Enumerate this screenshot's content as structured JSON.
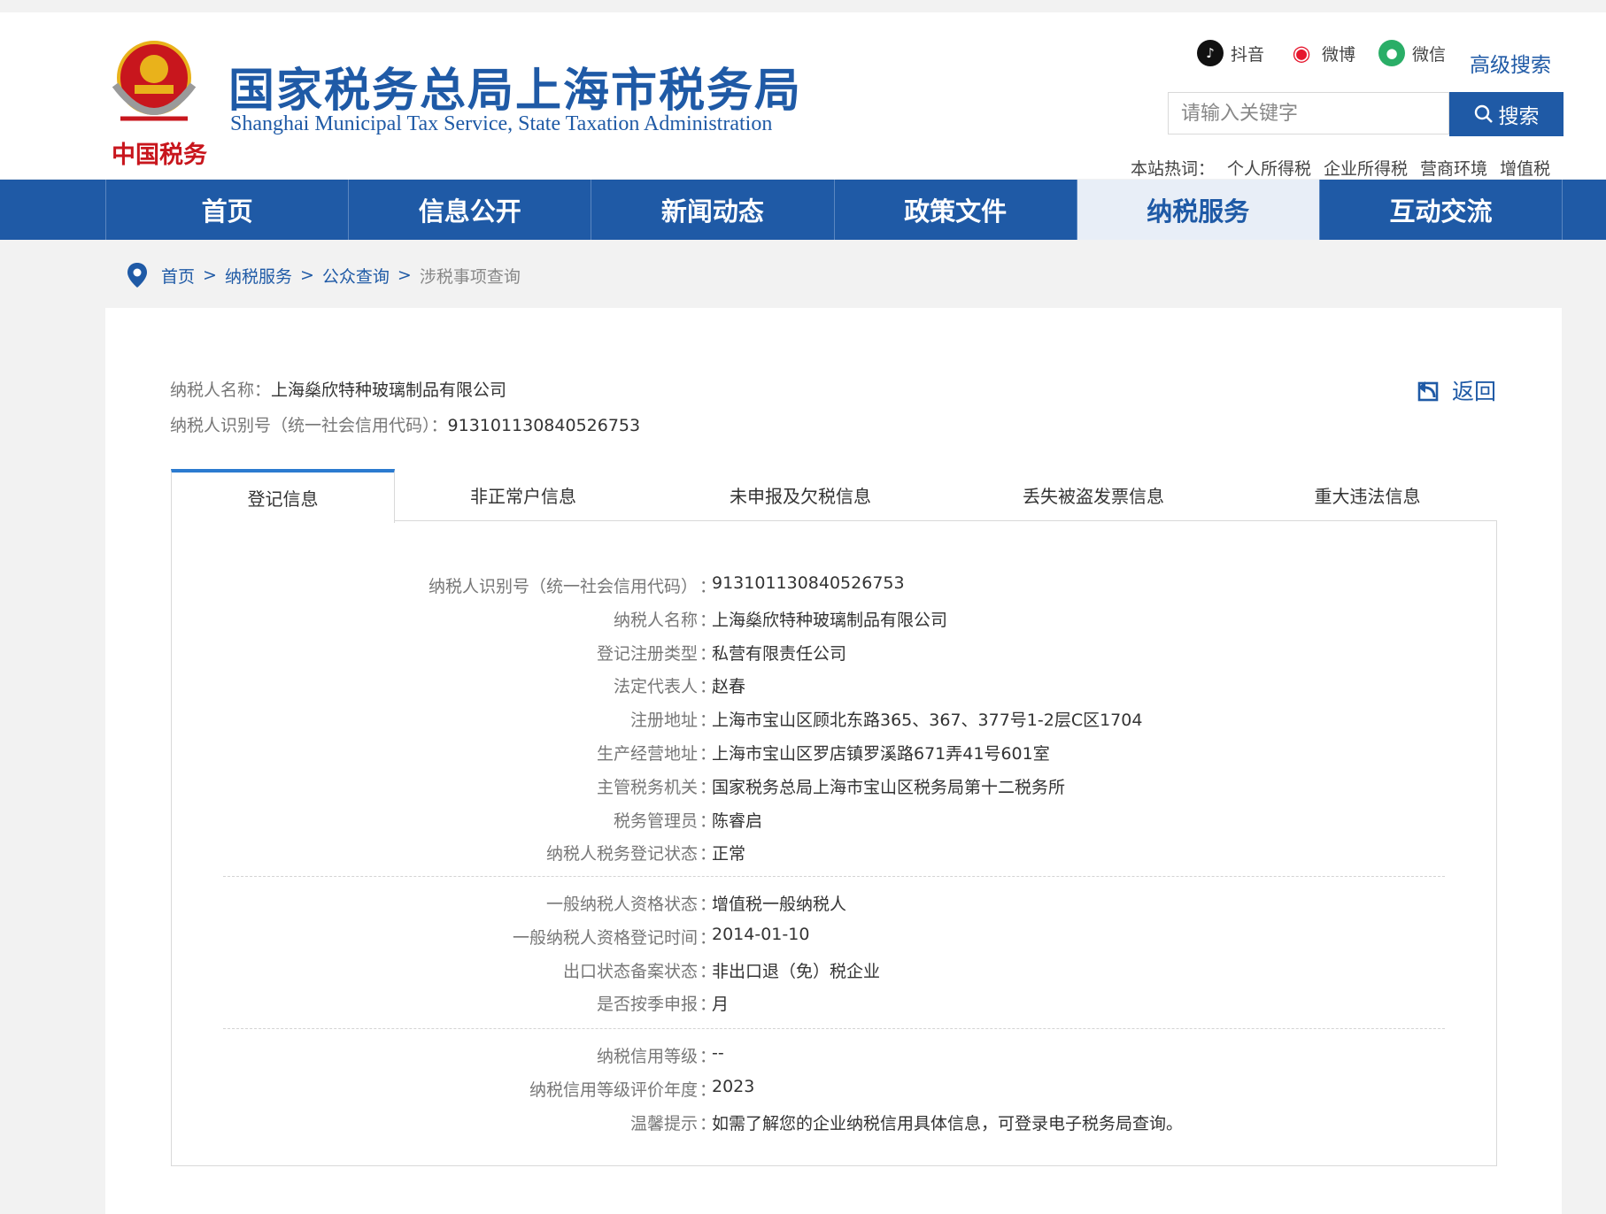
{
  "site": {
    "title": "国家税务总局上海市税务局",
    "subtitle": "Shanghai Municipal Tax Service, State Taxation Administration",
    "logo_text": "中国税务"
  },
  "social": [
    {
      "label": "抖音",
      "icon": "tiktok-icon",
      "color": "#111111"
    },
    {
      "label": "微博",
      "icon": "weibo-icon",
      "color": "#e6162d"
    },
    {
      "label": "微信",
      "icon": "wechat-icon",
      "color": "#2aae67"
    }
  ],
  "search": {
    "advanced_label": "高级搜索",
    "placeholder": "请输入关键字",
    "button_label": "搜索"
  },
  "hot": {
    "label": "本站热词：",
    "items": [
      "个人所得税",
      "企业所得税",
      "营商环境",
      "增值税"
    ]
  },
  "nav": {
    "items": [
      "首页",
      "信息公开",
      "新闻动态",
      "政策文件",
      "纳税服务",
      "互动交流"
    ],
    "active": "纳税服务"
  },
  "breadcrumb": {
    "items": [
      "首页",
      "纳税服务",
      "公众查询"
    ],
    "separator": ">",
    "current": "涉税事项查询"
  },
  "taxpayer": {
    "name_label": "纳税人名称：",
    "name": "上海燊欣特种玻璃制品有限公司",
    "id_label": "纳税人识别号（统一社会信用代码）：",
    "id": "913101130840526753"
  },
  "back_label": "返回",
  "tabs": [
    "登记信息",
    "非正常户信息",
    "未申报及欠税信息",
    "丢失被盗发票信息",
    "重大违法信息"
  ],
  "active_tab": "登记信息",
  "colon": "：",
  "groups": [
    [
      {
        "label": "纳税人识别号（统一社会信用代码）",
        "value": "913101130840526753"
      },
      {
        "label": "纳税人名称",
        "value": "上海燊欣特种玻璃制品有限公司"
      },
      {
        "label": "登记注册类型",
        "value": "私营有限责任公司"
      },
      {
        "label": "法定代表人",
        "value": "赵春"
      },
      {
        "label": "注册地址",
        "value": "上海市宝山区顾北东路365、367、377号1-2层C区1704"
      },
      {
        "label": "生产经营地址",
        "value": "上海市宝山区罗店镇罗溪路671弄41号601室"
      },
      {
        "label": "主管税务机关",
        "value": "国家税务总局上海市宝山区税务局第十二税务所"
      },
      {
        "label": "税务管理员",
        "value": "陈睿启"
      },
      {
        "label": "纳税人税务登记状态",
        "value": "正常"
      }
    ],
    [
      {
        "label": "一般纳税人资格状态",
        "value": "增值税一般纳税人"
      },
      {
        "label": "一般纳税人资格登记时间",
        "value": "2014-01-10"
      },
      {
        "label": "出口状态备案状态",
        "value": "非出口退（免）税企业"
      },
      {
        "label": "是否按季申报",
        "value": "月"
      }
    ],
    [
      {
        "label": "纳税信用等级",
        "value": "--"
      },
      {
        "label": "纳税信用等级评价年度",
        "value": "2023"
      },
      {
        "label": "温馨提示",
        "value": "如需了解您的企业纳税信用具体信息，可登录电子税务局查询。"
      }
    ]
  ]
}
